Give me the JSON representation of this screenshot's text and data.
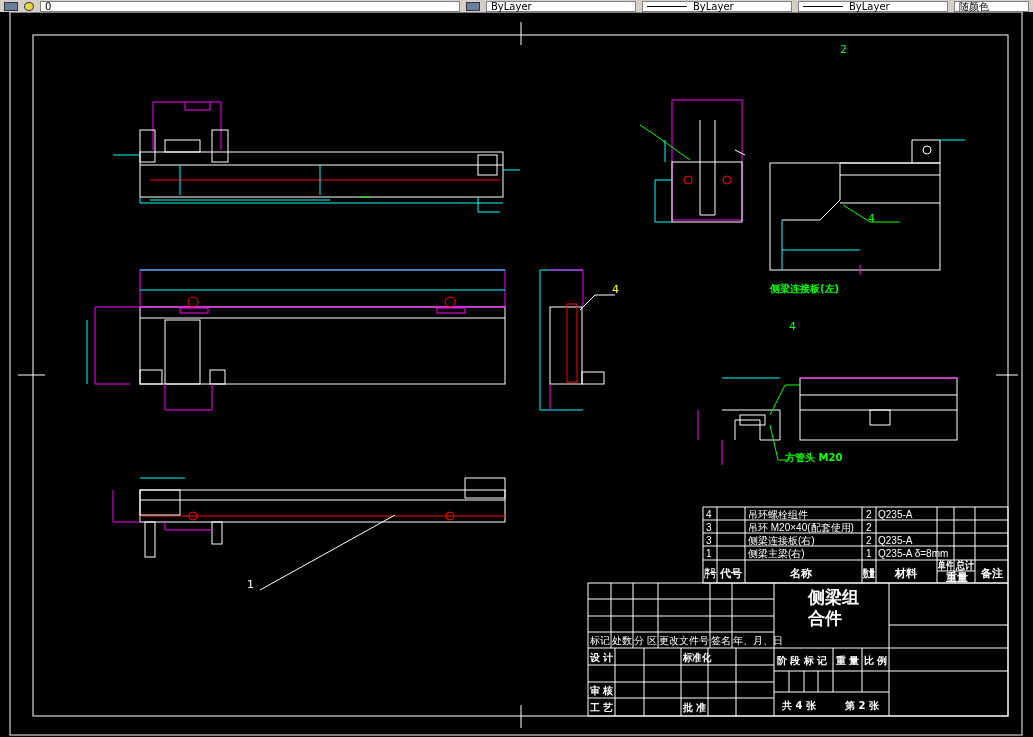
{
  "toolbar": {
    "layer": "0",
    "color_control": "ByLayer",
    "linetype": "ByLayer",
    "lineweight": "ByLayer",
    "plot_style": "随颜色"
  },
  "drawing": {
    "callouts": [
      "2",
      "4",
      "4",
      "4",
      "1"
    ],
    "notes": [
      "侧梁连接板(左)",
      "方管头 M20"
    ],
    "parts_list": {
      "header": [
        "序号",
        "代号",
        "名称",
        "数量",
        "材料",
        "单件",
        "总计",
        "重量",
        "备注"
      ],
      "rows": [
        {
          "number": "4",
          "name": "吊环螺栓组件",
          "quantity": "2",
          "material": "Q235-A"
        },
        {
          "number": "3",
          "name": "吊环 M20×40(配套使用)",
          "quantity": "2"
        },
        {
          "number": "3",
          "name": "侧梁连接板(右)",
          "quantity": "2",
          "material": "Q235-A"
        },
        {
          "number": "1",
          "name": "侧梁主梁(右)",
          "quantity": "1",
          "material": "Q235-A δ=8mm"
        }
      ]
    },
    "title_block": {
      "title": [
        "侧梁组",
        "合件"
      ],
      "revision_labels": [
        "标记",
        "处数",
        "分 区",
        "更改文件号",
        "签名",
        "年、月、日"
      ],
      "sign_labels": [
        "设 计",
        "标准化",
        "审 核",
        "工 艺",
        "批 准"
      ],
      "stage_labels": [
        "阶 段 标 记",
        "重 量",
        "比 例"
      ],
      "sheets": [
        "共 4 张",
        "第 2 张"
      ]
    }
  }
}
